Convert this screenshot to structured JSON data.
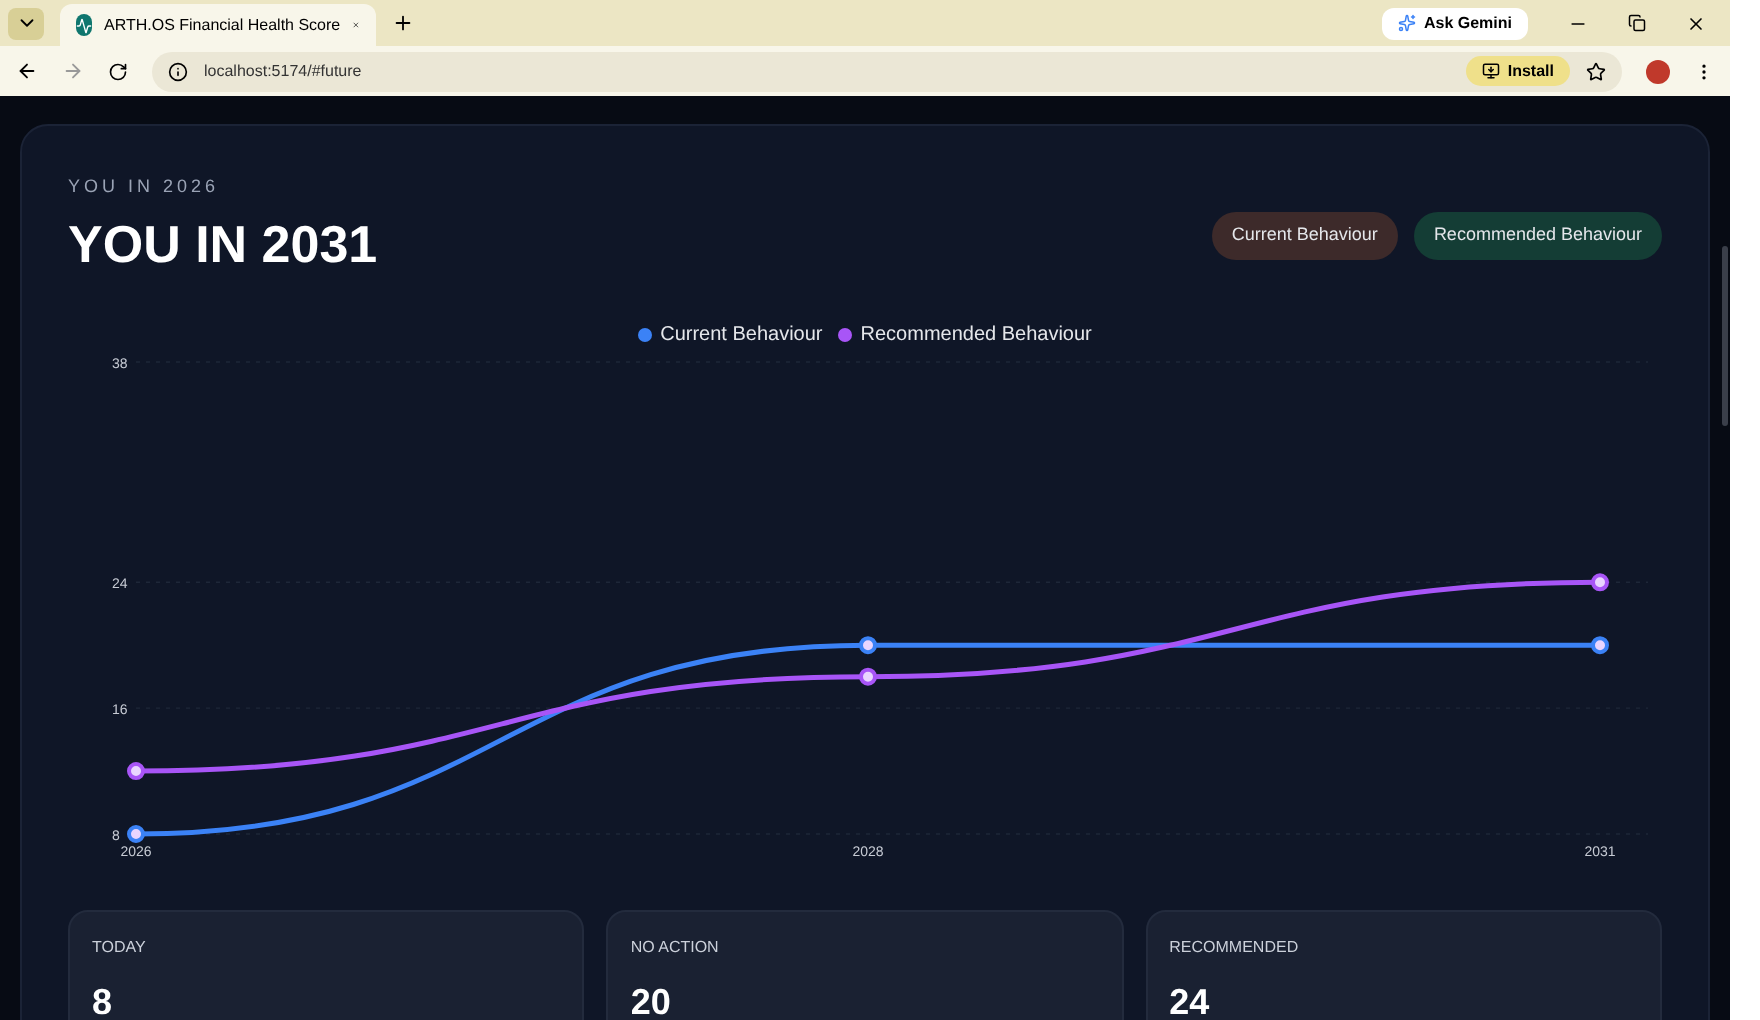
{
  "browser": {
    "tab_title": "ARTH.OS Financial Health Score",
    "address": "localhost:5174/#future",
    "ask_gemini": "Ask Gemini",
    "install": "Install"
  },
  "header": {
    "eyebrow": "YOU IN 2026",
    "title": "YOU IN 2031"
  },
  "toggles": [
    {
      "label": "Current Behaviour",
      "color": "#3d2a2a"
    },
    {
      "label": "Recommended Behaviour",
      "color": "#143d35"
    }
  ],
  "chart": {
    "chart_data": {
      "type": "line",
      "categories": [
        "2026",
        "2028",
        "2031"
      ],
      "ylim": [
        8,
        38
      ],
      "yticks": [
        8,
        16,
        24,
        38
      ],
      "series": [
        {
          "name": "Current Behaviour",
          "color": "#3b82f6",
          "marker": "circle",
          "values": [
            8,
            20,
            20
          ]
        },
        {
          "name": "Recommended Behaviour",
          "color": "#a855f7",
          "marker": "circle",
          "values": [
            12,
            18,
            24
          ]
        }
      ]
    }
  },
  "stats": [
    {
      "label": "TODAY",
      "value": "8"
    },
    {
      "label": "NO ACTION",
      "value": "20"
    },
    {
      "label": "RECOMMENDED",
      "value": "24"
    }
  ]
}
